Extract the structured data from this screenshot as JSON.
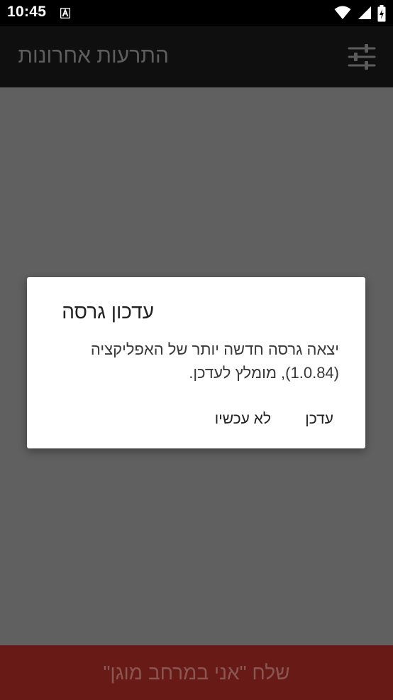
{
  "status_bar": {
    "time": "10:45",
    "notification_icon": "a-letter-notification-icon",
    "icons": [
      "wifi-icon",
      "signal-icon",
      "battery-charging-icon"
    ]
  },
  "app_bar": {
    "title": "התרעות אחרונות",
    "settings_icon": "sliders-icon"
  },
  "dialog": {
    "title": "עדכון גרסה",
    "message_line1": "יצאה גרסה חדשה יותר של האפליקציה",
    "message_line2": "(1.0.84), מומלץ לעדכן.",
    "update_label": "עדכן",
    "later_label": "לא עכשיו"
  },
  "bottom_button": {
    "label": "שלח \"אני במרחב מוגן\""
  },
  "colors": {
    "scrim": "#606060",
    "status_bar": "#000000",
    "app_bar": "#0f0f0f",
    "bottom_button": "#681b16",
    "dialog_bg": "#ffffff"
  }
}
